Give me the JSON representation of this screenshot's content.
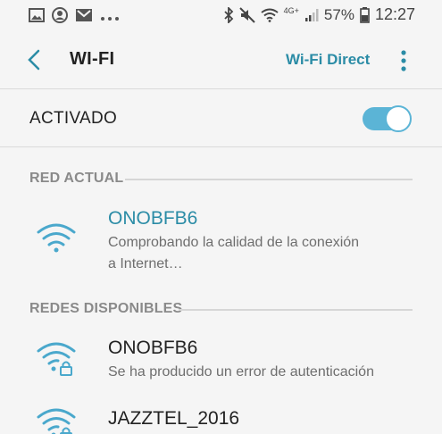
{
  "status_bar": {
    "battery": "57%",
    "time": "12:27",
    "network_type": "4G+",
    "left_icons": [
      "image-icon",
      "account-icon",
      "gmail-icon",
      "more-dots-icon"
    ],
    "right_icons": [
      "bluetooth-icon",
      "mute-icon",
      "wifi-icon",
      "signal-icon",
      "battery-icon"
    ]
  },
  "app_bar": {
    "title": "WI-FI",
    "action_label": "Wi-Fi Direct"
  },
  "toggle": {
    "label": "ACTIVADO",
    "on": true
  },
  "current_section": {
    "header": "RED ACTUAL",
    "network": {
      "name": "ONOBFB6",
      "status_line1": "Comprobando la calidad de la conexión",
      "status_line2": "a Internet…"
    }
  },
  "available_section": {
    "header": "REDES DISPONIBLES",
    "networks": [
      {
        "name": "ONOBFB6",
        "status": "Se ha producido un error de autenticación",
        "secured": true
      },
      {
        "name": "JAZZTEL_2016",
        "status": "",
        "secured": true
      }
    ]
  },
  "colors": {
    "accent": "#2b8ca6",
    "switch": "#5bb4d6",
    "background": "#f5f5f5"
  }
}
